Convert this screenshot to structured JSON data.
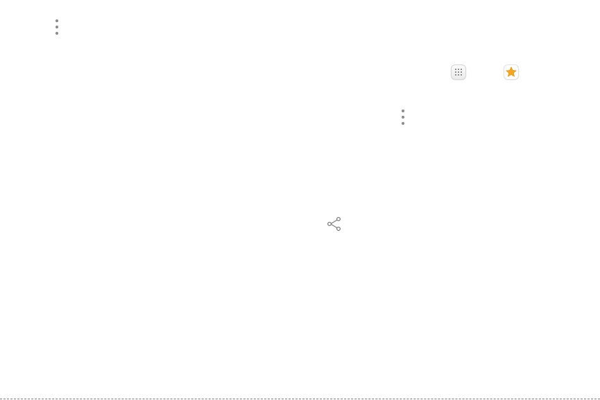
{
  "icons": {
    "more_options_top": "more-vertical-icon",
    "apps": "apps-grid-icon",
    "galaxy_apps": "star-icon",
    "more_options_middle": "more-vertical-icon",
    "share": "share-icon"
  },
  "colors": {
    "icon_gray": "#8a8a8a",
    "star_orange": "#f6a623"
  }
}
